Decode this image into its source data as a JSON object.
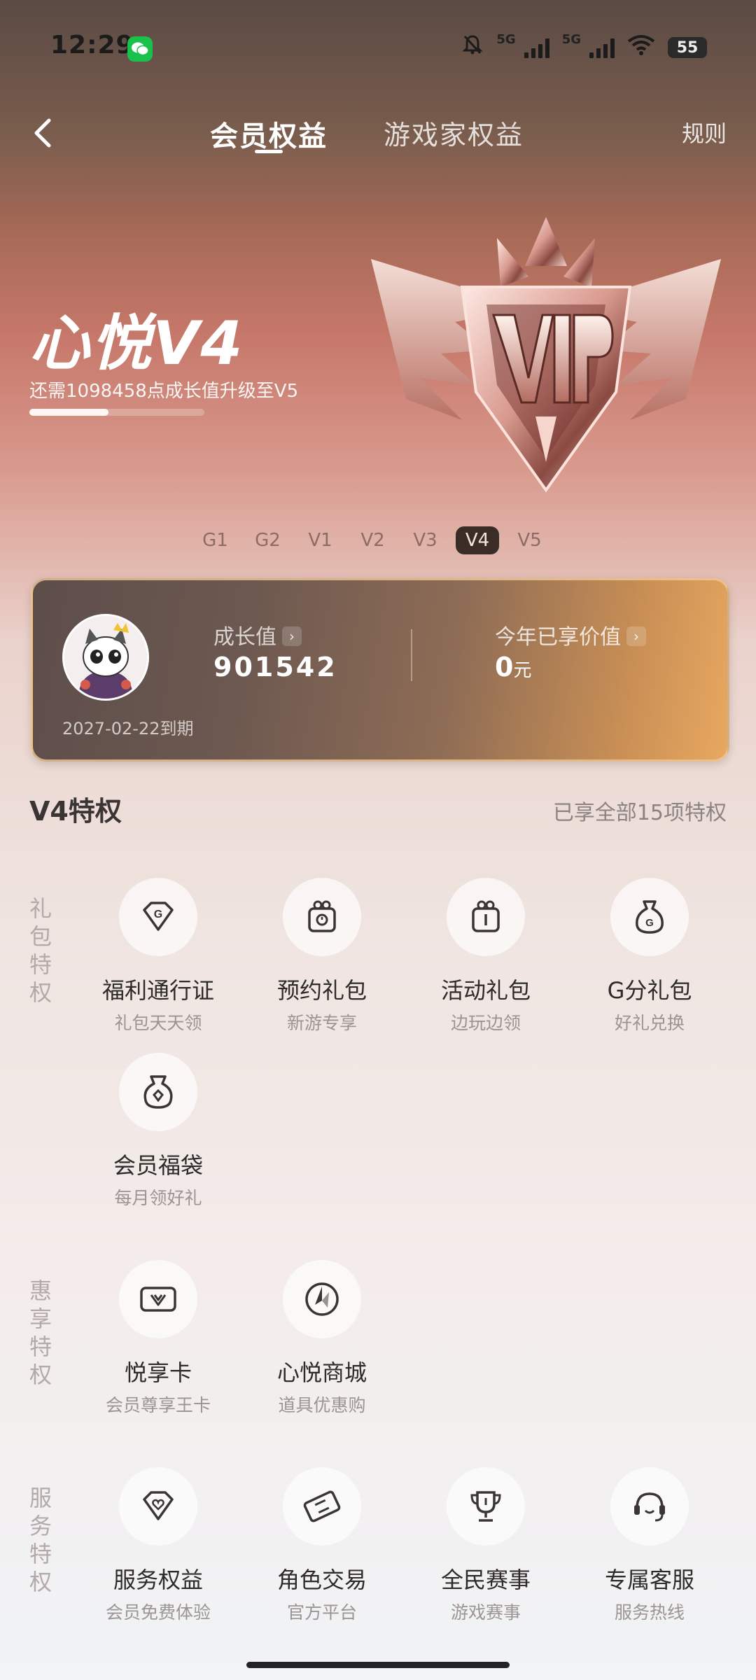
{
  "status_bar": {
    "time": "12:29",
    "network_1": "5G",
    "network_2": "5G",
    "battery": "55"
  },
  "nav": {
    "tab_active": "会员权益",
    "tab_inactive": "游戏家权益",
    "rules": "规则"
  },
  "hero": {
    "level_title": "心悦V4",
    "upgrade_text": "还需1098458点成长值升级至V5",
    "progress_fraction": 0.45,
    "badge_label": "VIP"
  },
  "levels": [
    "G1",
    "G2",
    "V1",
    "V2",
    "V3",
    "V4",
    "V5"
  ],
  "active_level": "V4",
  "card": {
    "growth_label": "成长值",
    "growth_value": "901542",
    "value_label": "今年已享价值",
    "value_amount": "0",
    "value_unit": "元",
    "expire": "2027-02-22到期"
  },
  "privileges": {
    "title": "V4特权",
    "count_text": "已享全部15项特权",
    "sections": [
      {
        "label": "礼包特权",
        "items": [
          {
            "name": "福利通行证",
            "desc": "礼包天天领",
            "icon": "gift-diamond-icon"
          },
          {
            "name": "预约礼包",
            "desc": "新游专享",
            "icon": "reserve-gift-icon"
          },
          {
            "name": "活动礼包",
            "desc": "边玩边领",
            "icon": "activity-gift-icon"
          },
          {
            "name": "G分礼包",
            "desc": "好礼兑换",
            "icon": "money-bag-icon"
          },
          {
            "name": "会员福袋",
            "desc": "每月领好礼",
            "icon": "lucky-bag-icon"
          }
        ]
      },
      {
        "label": "惠享特权",
        "items": [
          {
            "name": "悦享卡",
            "desc": "会员尊享王卡",
            "icon": "card-icon"
          },
          {
            "name": "心悦商城",
            "desc": "道具优惠购",
            "icon": "mall-icon"
          }
        ]
      },
      {
        "label": "服务特权",
        "items": [
          {
            "name": "服务权益",
            "desc": "会员免费体验",
            "icon": "service-heart-icon"
          },
          {
            "name": "角色交易",
            "desc": "官方平台",
            "icon": "ticket-icon"
          },
          {
            "name": "全民赛事",
            "desc": "游戏赛事",
            "icon": "trophy-icon"
          },
          {
            "name": "专属客服",
            "desc": "服务热线",
            "icon": "headset-icon"
          }
        ]
      }
    ]
  }
}
